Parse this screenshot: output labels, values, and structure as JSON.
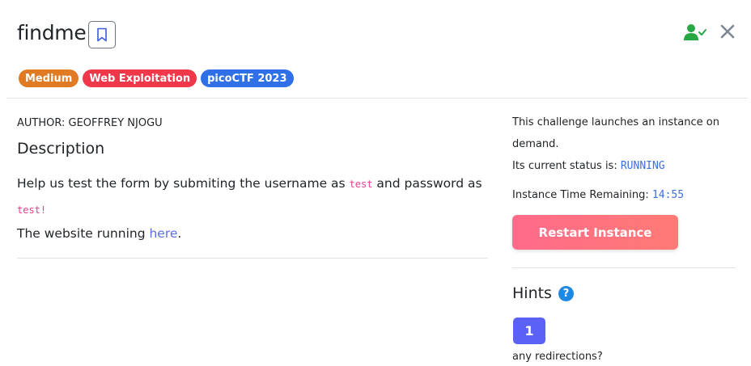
{
  "header": {
    "title": "findme"
  },
  "badges": [
    {
      "label": "Medium",
      "color": "#e07b24"
    },
    {
      "label": "Web Exploitation",
      "color": "#f0384a"
    },
    {
      "label": "picoCTF 2023",
      "color": "#2f6fe8"
    }
  ],
  "main": {
    "author": "AUTHOR: GEOFFREY NJOGU",
    "description_heading": "Description",
    "desc_part1": "Help us test the form by submiting the username as ",
    "desc_code1": "test",
    "desc_part2": " and password as ",
    "desc_code2": "test!",
    "desc_part3": "The website running ",
    "desc_link": "here",
    "desc_part4": "."
  },
  "instance": {
    "launch_text_line1": "This challenge launches an instance on",
    "launch_text_line2": "demand.",
    "status_label": "Its current status is: ",
    "status_value": "RUNNING",
    "time_label": "Instance Time Remaining: ",
    "time_value": "14:55",
    "restart_label": "Restart Instance"
  },
  "hints": {
    "heading": "Hints",
    "help_glyph": "?",
    "items": [
      {
        "number": "1",
        "text": "any redirections?"
      }
    ]
  },
  "colors": {
    "user_check": "#28a745",
    "close": "#7d8794",
    "restart_gradient_start": "#ff6b8a",
    "restart_gradient_end": "#ff7a75",
    "hint_button": "#5b61f5"
  }
}
